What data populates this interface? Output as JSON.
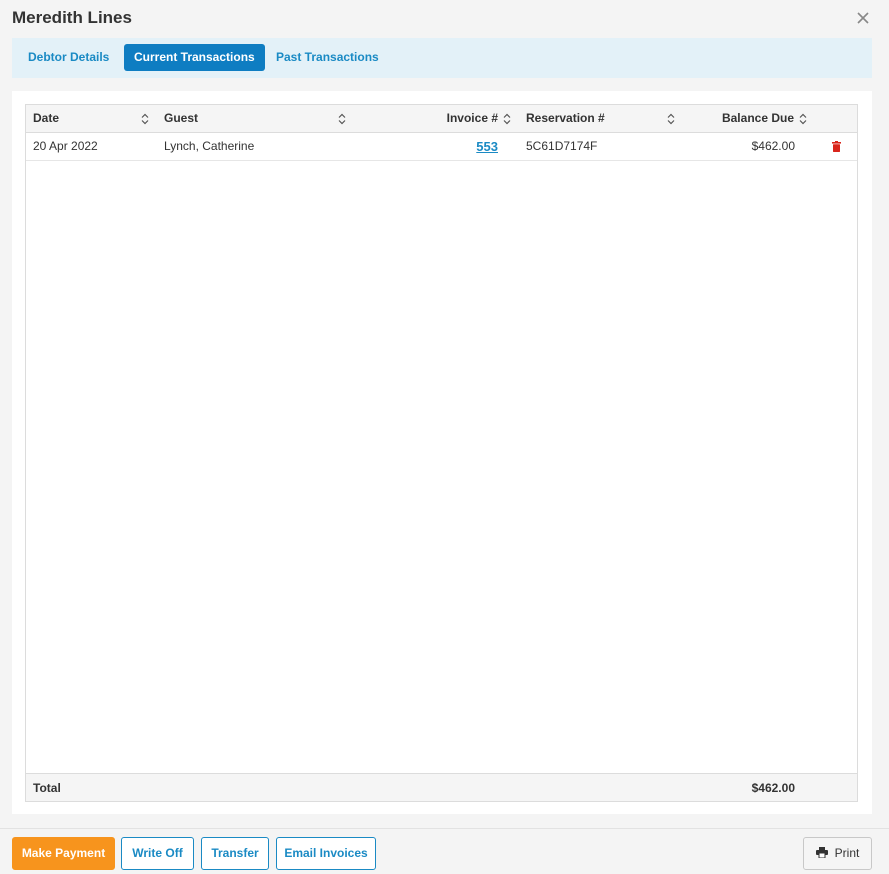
{
  "modal": {
    "title": "Meredith Lines"
  },
  "tabs": [
    {
      "label": "Debtor Details"
    },
    {
      "label": "Current Transactions"
    },
    {
      "label": "Past Transactions"
    }
  ],
  "table": {
    "columns": [
      "Date",
      "Guest",
      "Invoice #",
      "Reservation #",
      "Balance Due"
    ],
    "rows": [
      {
        "date": "20 Apr 2022",
        "guest": "Lynch, Catherine",
        "invoice": "553",
        "reservation": "5C61D7174F",
        "balance": "$462.00"
      }
    ],
    "footer": {
      "label": "Total",
      "total": "$462.00"
    }
  },
  "actions": {
    "make_payment": "Make Payment",
    "write_off": "Write Off",
    "transfer": "Transfer",
    "email_invoices": "Email Invoices",
    "print": "Print"
  },
  "colors": {
    "accent": "#0e7dc2",
    "link": "#1a8ac4",
    "primary_button": "#f7941d",
    "delete": "#d9261c",
    "tab_bar": "#e3f1f8"
  },
  "icons": [
    "close-icon",
    "sort-icon",
    "trash-icon",
    "print-icon"
  ]
}
